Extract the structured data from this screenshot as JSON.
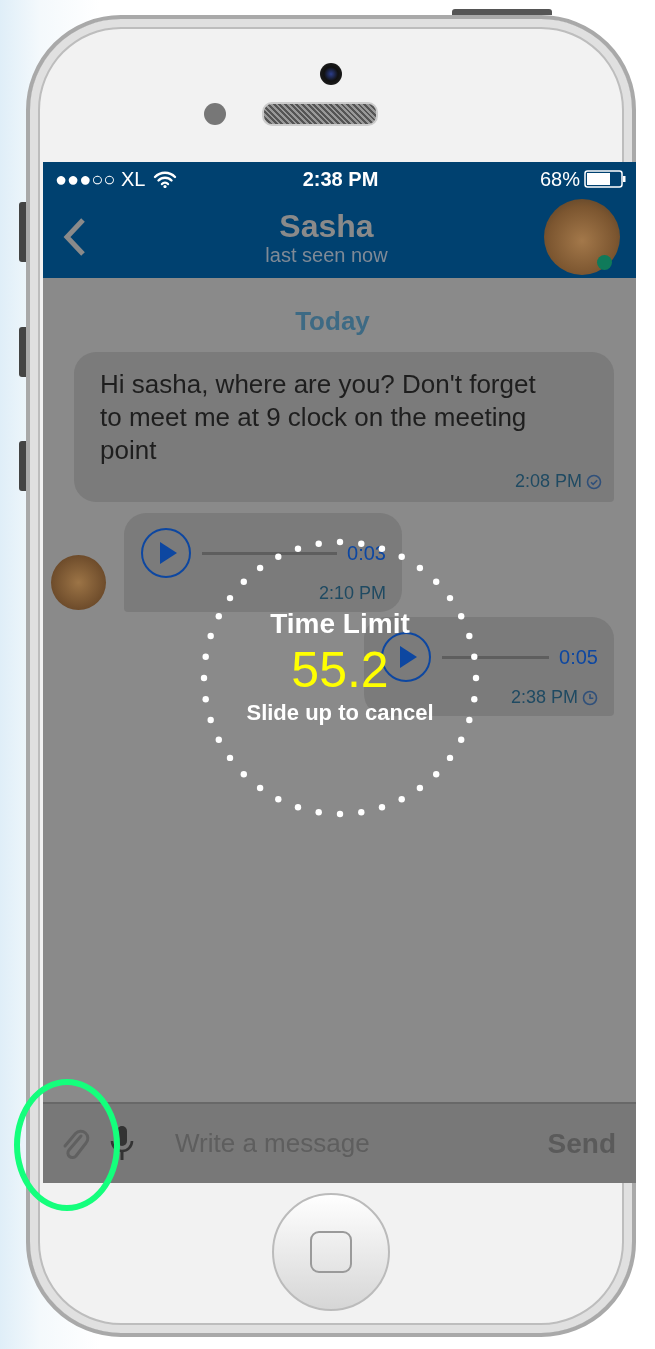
{
  "status_bar": {
    "carrier": "●●●○○ XL",
    "time": "2:38 PM",
    "battery": "68%"
  },
  "header": {
    "title": "Sasha",
    "subtitle": "last seen now",
    "online": true
  },
  "date_divider": "Today",
  "messages": [
    {
      "kind": "text",
      "outgoing": true,
      "text": "Hi sasha, where are you?  Don't forget to meet me at 9 clock on the meeting point",
      "time": "2:08 PM",
      "sent": true
    },
    {
      "kind": "voice",
      "outgoing": false,
      "duration": "0:03",
      "time": "2:10 PM"
    },
    {
      "kind": "voice",
      "outgoing": true,
      "duration": "0:05",
      "time": "2:38 PM",
      "sent": false
    }
  ],
  "recording_overlay": {
    "title": "Time Limit",
    "countdown": "55.2",
    "hint": "Slide up to cancel"
  },
  "composer": {
    "placeholder": "Write a message",
    "send": "Send"
  }
}
